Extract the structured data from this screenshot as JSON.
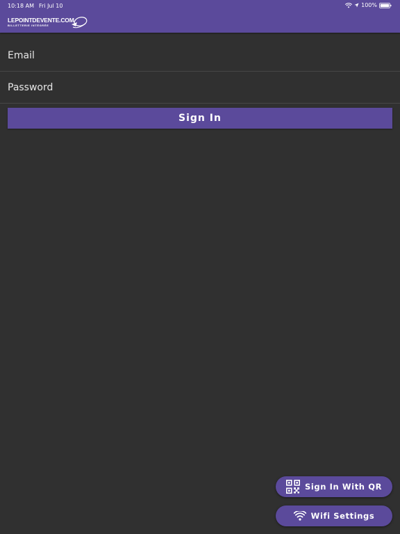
{
  "status_bar": {
    "time": "10:18 AM",
    "date": "Fri Jul 10",
    "battery": "100%"
  },
  "header": {
    "logo_name": "LEPOINTDEVENTE.COM",
    "logo_tagline": "BILLETTERIE INTÉGRÉE",
    "background": "#5b4a9b"
  },
  "form": {
    "email_placeholder": "Email",
    "password_placeholder": "Password",
    "sign_in_label": "Sign In"
  },
  "actions": {
    "qr_label": "Sign In With QR",
    "qr_icon": "qr-code-icon",
    "wifi_label": "Wifi Settings",
    "wifi_icon": "wifi-icon"
  },
  "colors": {
    "accent": "#5b4a9b",
    "background": "#303030"
  }
}
